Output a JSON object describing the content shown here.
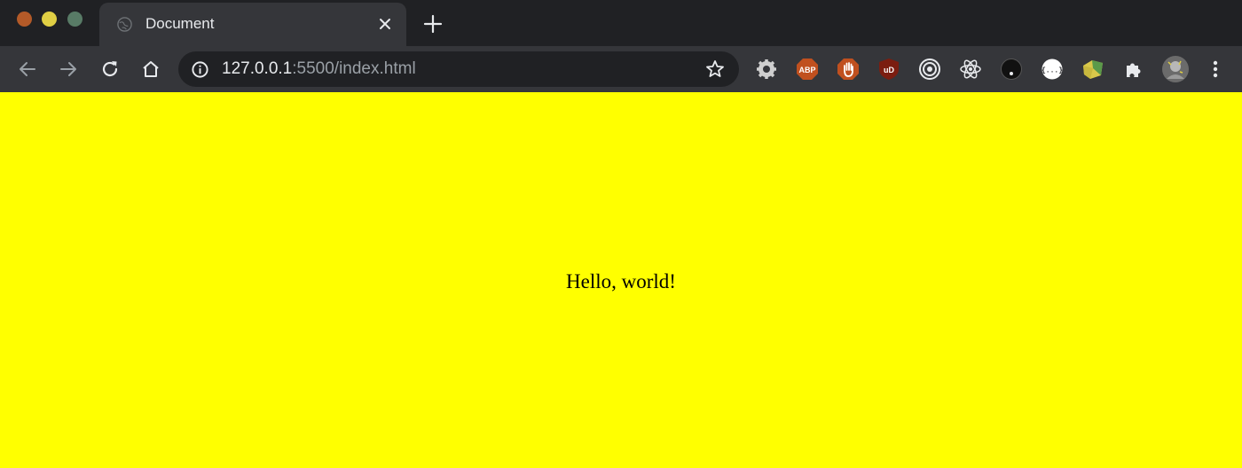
{
  "window": {
    "traffic_lights": {
      "close": "#b35a28",
      "minimize": "#e0cf44",
      "maximize": "#587b66"
    }
  },
  "tab": {
    "title": "Document",
    "favicon": "globe-icon"
  },
  "toolbar": {
    "address": {
      "host": "127.0.0.1",
      "rest": ":5500/index.html"
    },
    "extensions": [
      {
        "name": "settings-gear-extension-icon"
      },
      {
        "name": "adblock-plus-extension-icon",
        "label": "ABP"
      },
      {
        "name": "stop-hand-extension-icon"
      },
      {
        "name": "ublock-extension-icon",
        "label": "uD"
      },
      {
        "name": "target-rings-extension-icon"
      },
      {
        "name": "react-devtools-extension-icon"
      },
      {
        "name": "dark-circle-extension-icon"
      },
      {
        "name": "json-viewer-extension-icon",
        "label": "{...}"
      },
      {
        "name": "folder-extension-icon"
      },
      {
        "name": "puzzle-extensions-icon"
      },
      {
        "name": "profile-avatar"
      }
    ]
  },
  "page": {
    "background": "#ffff00",
    "text": "Hello, world!"
  }
}
